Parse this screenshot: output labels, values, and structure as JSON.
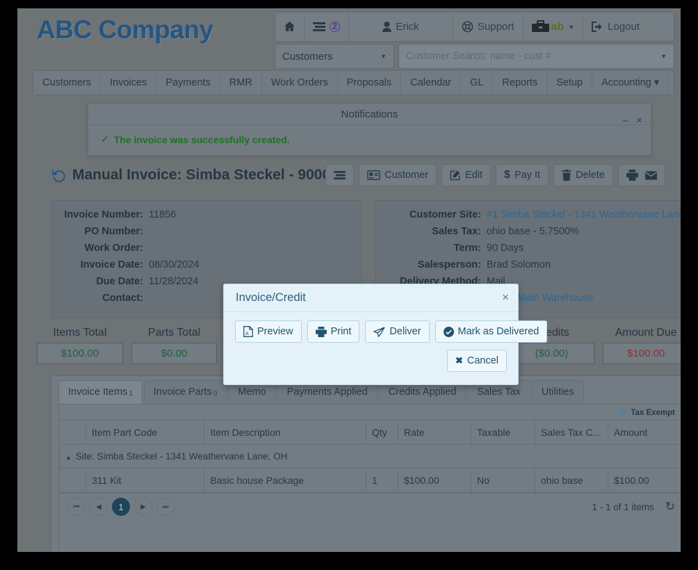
{
  "brand": "ABC Company",
  "topbar": {
    "home_icon": "home-icon",
    "list_icon": "list-icon",
    "notification_count": "2",
    "user_icon": "user-icon",
    "user_name": "Erick",
    "support_icon": "lifebuoy-icon",
    "support_label": "Support",
    "briefcase_icon": "briefcase-icon",
    "briefcase_label": "ab",
    "logout_icon": "logout-icon",
    "logout_label": "Logout"
  },
  "search": {
    "module_selected": "Customers",
    "placeholder": "Customer Search: name - cust #",
    "value": ""
  },
  "nav": {
    "items": [
      {
        "label": "Customers"
      },
      {
        "label": "Invoices"
      },
      {
        "label": "Payments"
      },
      {
        "label": "RMR"
      },
      {
        "label": "Work Orders"
      },
      {
        "label": "Proposals"
      },
      {
        "label": "Calendar"
      },
      {
        "label": "GL"
      },
      {
        "label": "Reports"
      },
      {
        "label": "Setup"
      },
      {
        "label": "Accounting ▾"
      }
    ]
  },
  "notifications": {
    "title": "Notifications",
    "minimize": "–",
    "close": "×",
    "message": "The invoice was successfully created.",
    "check": "✓"
  },
  "page": {
    "title": "Manual Invoice: Simba Steckel - 9000",
    "history_icon": "history-icon",
    "actions": [
      {
        "name": "list-view-button",
        "icon": "list-icon",
        "label": ""
      },
      {
        "name": "customer-button",
        "icon": "id-card-icon",
        "label": "Customer"
      },
      {
        "name": "edit-button",
        "icon": "pencil-square-icon",
        "label": "Edit"
      },
      {
        "name": "pay-it-button",
        "icon": "dollar-icon",
        "label": "Pay It"
      },
      {
        "name": "delete-button",
        "icon": "trash-icon",
        "label": "Delete"
      },
      {
        "name": "print-email-button",
        "icon": "printer-envelope-icon",
        "label": ""
      }
    ]
  },
  "invoice_info": {
    "left": [
      {
        "label": "Invoice Number:",
        "value": "11856",
        "link": false
      },
      {
        "label": "PO Number:",
        "value": "",
        "link": false
      },
      {
        "label": "Work Order:",
        "value": "",
        "link": false
      },
      {
        "label": "Invoice Date:",
        "value": "08/30/2024",
        "link": false
      },
      {
        "label": "Due Date:",
        "value": "11/28/2024",
        "link": false
      },
      {
        "label": "Contact:",
        "value": "",
        "link": false
      }
    ],
    "right": [
      {
        "label": "Customer Site:",
        "value": "#1 Simba Steckel - 1341 Weathervane Lane",
        "link": true
      },
      {
        "label": "Sales Tax:",
        "value": "ohio base - 5.7500%",
        "link": false
      },
      {
        "label": "Term:",
        "value": "90 Days",
        "link": false
      },
      {
        "label": "Salesperson:",
        "value": "Brad Solomon",
        "link": false
      },
      {
        "label": "Delivery Method:",
        "value": "Mail",
        "link": false
      },
      {
        "label": "",
        "value": "ouse - Main Warehouse",
        "link": true
      }
    ]
  },
  "totals": [
    {
      "label": "Items Total",
      "value": "$100.00",
      "due": false
    },
    {
      "label": "Parts Total",
      "value": "$0.00",
      "due": false
    },
    {
      "label": "",
      "value": "",
      "due": false
    },
    {
      "label": "",
      "value": "",
      "due": false
    },
    {
      "label": "",
      "value": "",
      "due": false
    },
    {
      "label": "Credits",
      "value": "($0.00)",
      "due": false
    },
    {
      "label": "Amount Due",
      "value": "$100.00",
      "due": true
    }
  ],
  "tabs": [
    {
      "label": "Invoice Items",
      "count": "1",
      "active": true
    },
    {
      "label": "Invoice Parts",
      "count": "0",
      "active": false
    },
    {
      "label": "Memo",
      "count": "",
      "active": false
    },
    {
      "label": "Payments Applied",
      "count": "",
      "active": false
    },
    {
      "label": "Credits Applied",
      "count": "",
      "active": false
    },
    {
      "label": "Sales Tax",
      "count": "",
      "active": false
    },
    {
      "label": "Utilities",
      "count": "",
      "active": false
    }
  ],
  "grid": {
    "legend_label": "Tax Exempt",
    "legend_color": "#6d94b5",
    "columns": [
      "",
      "Item Part Code",
      "Item Description",
      "Qty",
      "Rate",
      "Taxable",
      "Sales Tax C...",
      "Amount"
    ],
    "group_row": "Site: Simba Steckel - 1341 Weathervane Lane, OH",
    "rows": [
      {
        "item_part_code": "311 Kit",
        "item_description": "Basic house Package",
        "qty": "1",
        "rate": "$100.00",
        "taxable": "No",
        "sales_tax_code": "ohio base",
        "amount": "$100.00"
      }
    ],
    "pager": {
      "first": "⏮",
      "prev": "◀",
      "current": "1",
      "next": "▶",
      "last": "⏭",
      "info": "1 - 1 of 1 items",
      "refresh_icon": "refresh-icon"
    }
  },
  "modal": {
    "title": "Invoice/Credit",
    "close": "×",
    "buttons": [
      {
        "name": "preview-button",
        "icon": "pdf-file-icon",
        "label": "Preview"
      },
      {
        "name": "print-button",
        "icon": "printer-icon",
        "label": "Print"
      },
      {
        "name": "deliver-button",
        "icon": "paper-plane-icon",
        "label": "Deliver"
      },
      {
        "name": "mark-delivered-button",
        "icon": "check-circle-icon",
        "label": "Mark as Delivered"
      }
    ],
    "cancel_label": "Cancel",
    "cancel_icon": "x-mark-icon"
  }
}
